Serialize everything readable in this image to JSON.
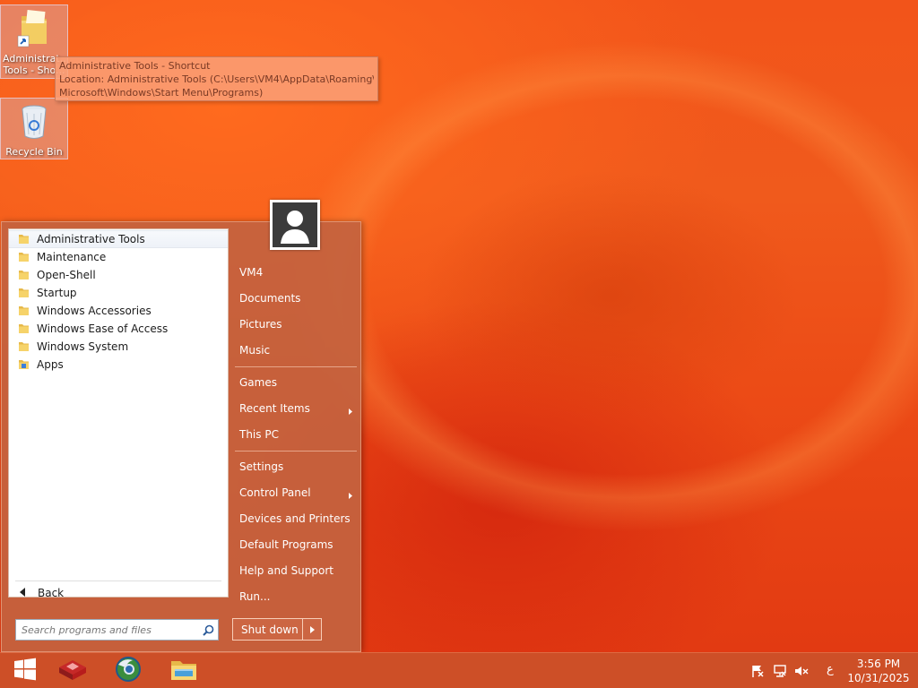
{
  "desktop": {
    "icons": [
      {
        "label": "Administrative Tools - Shortcut",
        "label_display": "Administrat...",
        "label_line2": "Tools - Sho...",
        "icon": "folder-shortcut-icon"
      },
      {
        "label": "Recycle Bin",
        "icon": "recycle-bin-icon"
      }
    ],
    "tooltip": {
      "line1": "Administrative Tools - Shortcut",
      "line2": "Location: Administrative Tools (C:\\Users\\VM4\\AppData\\Roaming\\",
      "line3": "Microsoft\\Windows\\Start Menu\\Programs)"
    }
  },
  "start_menu": {
    "programs": [
      {
        "label": "Administrative Tools",
        "icon": "folder-icon"
      },
      {
        "label": "Maintenance",
        "icon": "folder-icon"
      },
      {
        "label": "Open-Shell",
        "icon": "folder-icon"
      },
      {
        "label": "Startup",
        "icon": "folder-icon"
      },
      {
        "label": "Windows Accessories",
        "icon": "folder-icon"
      },
      {
        "label": "Windows Ease of Access",
        "icon": "folder-icon"
      },
      {
        "label": "Windows System",
        "icon": "folder-icon"
      },
      {
        "label": "Apps",
        "icon": "apps-folder-icon"
      }
    ],
    "back_label": "Back",
    "search_placeholder": "Search programs and files",
    "right_items": [
      {
        "label": "VM4"
      },
      {
        "label": "Documents"
      },
      {
        "label": "Pictures"
      },
      {
        "label": "Music"
      },
      {
        "label": "Games"
      },
      {
        "label": "Recent Items",
        "submenu": true
      },
      {
        "label": "This PC"
      },
      {
        "label": "Settings"
      },
      {
        "label": "Control Panel",
        "submenu": true
      },
      {
        "label": "Devices and Printers"
      },
      {
        "label": "Default Programs"
      },
      {
        "label": "Help and Support"
      },
      {
        "label": "Run..."
      }
    ],
    "shutdown_label": "Shut down"
  },
  "taskbar": {
    "start_icon": "windows-logo-icon",
    "pinned": [
      "app-red-icon",
      "browser-icon",
      "file-explorer-icon"
    ],
    "tray": {
      "icons": [
        "action-center-flag-icon",
        "network-icon",
        "volume-muted-icon"
      ],
      "language": "ع",
      "time": "3:56 PM",
      "date": "10/31/2025"
    }
  },
  "colors": {
    "accent": "#c4623e",
    "taskbar": "#cb4f28",
    "wallpaper": "#f05a1c"
  }
}
